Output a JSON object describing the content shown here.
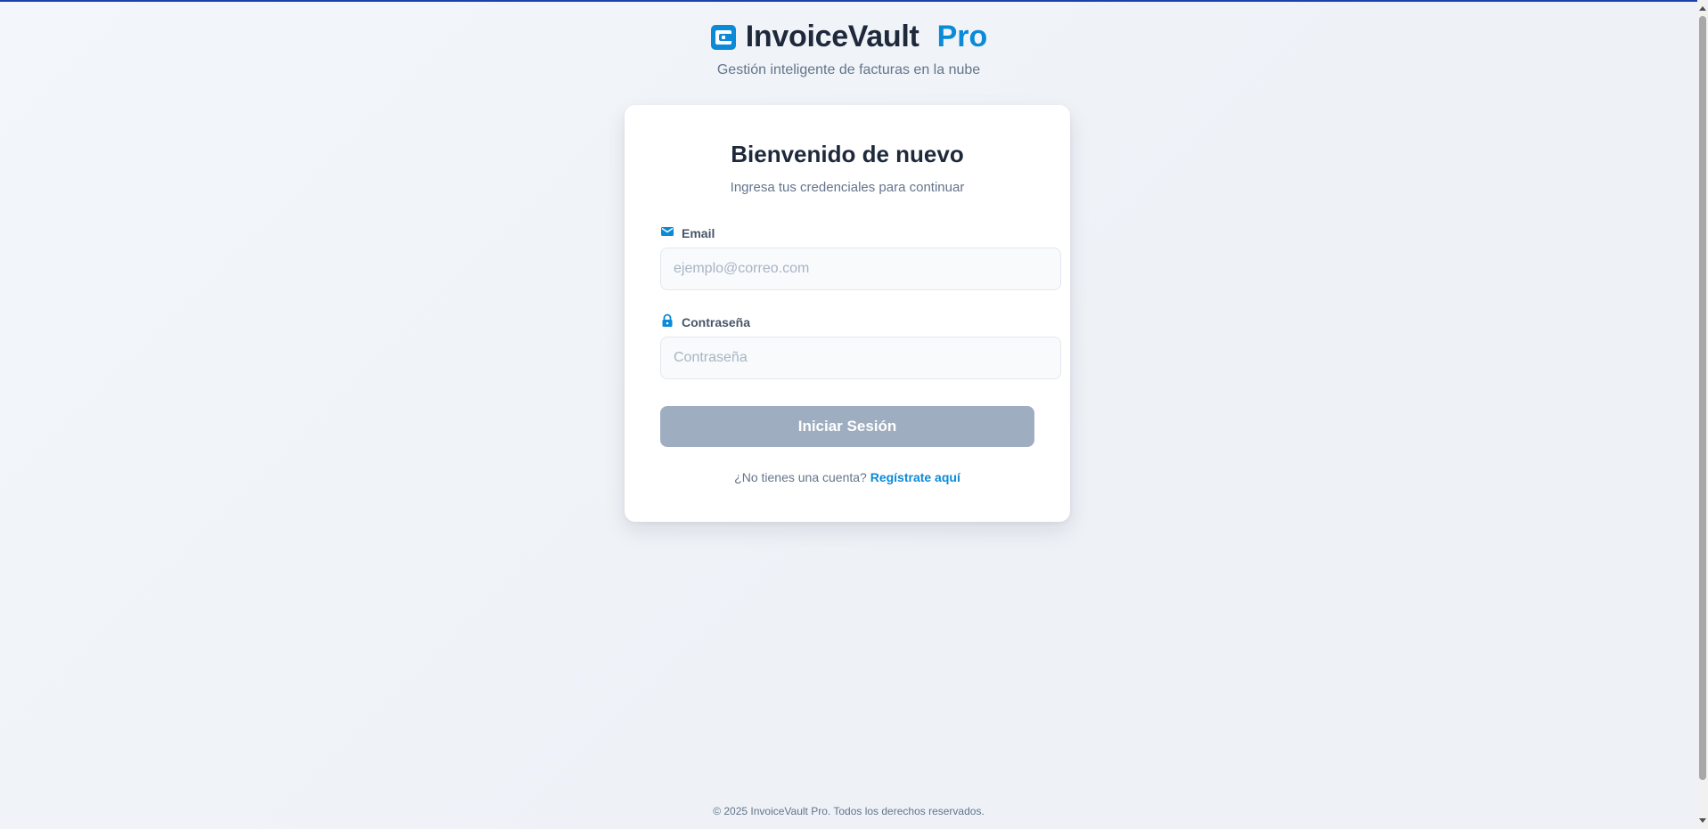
{
  "brand": {
    "name": "InvoiceVault",
    "suffix": "Pro",
    "tagline": "Gestión inteligente de facturas en la nube",
    "logo_icon": "wallet-icon",
    "colors": {
      "primary": "#0b8ad8",
      "dark": "#1e293b"
    }
  },
  "login": {
    "title": "Bienvenido de nuevo",
    "subtitle": "Ingresa tus credenciales para continuar",
    "email": {
      "label": "Email",
      "icon": "mail-icon",
      "value": "",
      "placeholder": "ejemplo@correo.com"
    },
    "password": {
      "label": "Contraseña",
      "icon": "lock-icon",
      "value": "",
      "placeholder": "Contraseña"
    },
    "submit_label": "Iniciar Sesión",
    "submit_color": "#9fadc0",
    "signup_prompt": "¿No tienes una cuenta?",
    "signup_link": "Regístrate aquí"
  },
  "footer": {
    "text": "© 2025 InvoiceVault Pro. Todos los derechos reservados."
  }
}
